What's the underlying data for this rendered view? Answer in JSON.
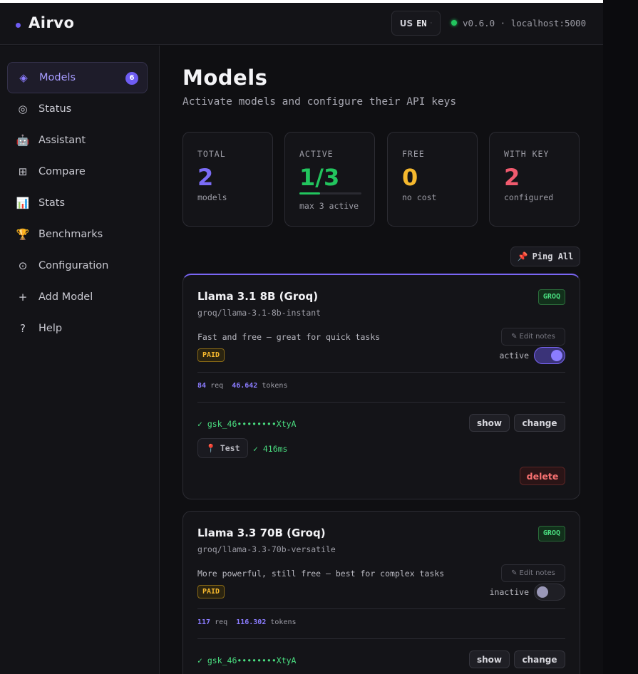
{
  "app": {
    "name": "Airvo"
  },
  "header": {
    "lang_country": "US",
    "lang_code": "EN",
    "version": "v0.6.0 · localhost:5000"
  },
  "sidebar": {
    "items": [
      {
        "label": "Models",
        "icon": "◈",
        "badge": "6",
        "active": true
      },
      {
        "label": "Status",
        "icon": "◎"
      },
      {
        "label": "Assistant",
        "icon": "🤖"
      },
      {
        "label": "Compare",
        "icon": "⊞"
      },
      {
        "label": "Stats",
        "icon": "📊"
      },
      {
        "label": "Benchmarks",
        "icon": "🏆"
      },
      {
        "label": "Configuration",
        "icon": "⊙"
      },
      {
        "label": "Add Model",
        "icon": "+"
      },
      {
        "label": "Help",
        "icon": "?"
      }
    ]
  },
  "page": {
    "title": "Models",
    "subtitle": "Activate models and configure their API keys"
  },
  "stats": {
    "total": {
      "label": "TOTAL",
      "value": "2",
      "sub": "models",
      "color": "#7b6cf6"
    },
    "active": {
      "label": "ACTIVE",
      "value": "1/3",
      "sub": "max 3 active",
      "progress": 0.33,
      "color": "#22c55e"
    },
    "free": {
      "label": "FREE",
      "value": "0",
      "sub": "no cost",
      "color": "#f5b82e"
    },
    "with_key": {
      "label": "WITH KEY",
      "value": "2",
      "sub": "configured",
      "color": "#f05a6e"
    }
  },
  "ping_all": {
    "label": "Ping All",
    "icon": "📌"
  },
  "models": [
    {
      "name": "Llama 3.1 8B (Groq)",
      "id": "groq/llama-3.1-8b-instant",
      "provider": "GROQ",
      "description": "Fast and free — great for quick tasks",
      "edit_notes": "Edit notes",
      "tier": "PAID",
      "state_label": "active",
      "enabled": true,
      "req_count": "84",
      "req_label": "req",
      "tokens_count": "46.642",
      "tokens_label": "tokens",
      "key": "✓ gsk_46••••••••XtyA",
      "show_label": "show",
      "change_label": "change",
      "test_label": "Test",
      "latency": "✓ 416ms",
      "delete_label": "delete"
    },
    {
      "name": "Llama 3.3 70B (Groq)",
      "id": "groq/llama-3.3-70b-versatile",
      "provider": "GROQ",
      "description": "More powerful, still free — best for complex tasks",
      "edit_notes": "Edit notes",
      "tier": "PAID",
      "state_label": "inactive",
      "enabled": false,
      "req_count": "117",
      "req_label": "req",
      "tokens_count": "116.302",
      "tokens_label": "tokens",
      "key": "✓ gsk_46••••••••XtyA",
      "show_label": "show",
      "change_label": "change"
    }
  ]
}
